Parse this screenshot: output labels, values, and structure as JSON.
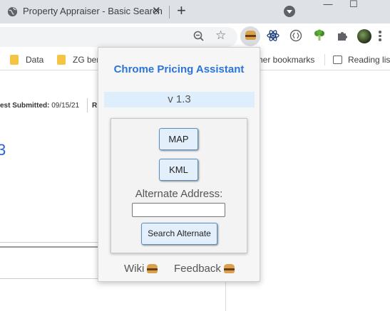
{
  "browser": {
    "tab": {
      "title": "Property Appraiser - Basic Search",
      "close": "✕"
    },
    "new_tab": "+",
    "window_controls": {
      "minimize": "—",
      "maximize": "☐"
    },
    "bookmarks": [
      {
        "label": "Data",
        "icon": "folder-icon"
      },
      {
        "label": "ZG ber",
        "icon": "folder-icon"
      },
      {
        "label": "her bookmarks",
        "icon": "none"
      },
      {
        "label": "Reading list",
        "icon": "reading-list-icon"
      }
    ],
    "extensions": [
      "burger-extension-icon",
      "react-icon",
      "code-bracket-icon",
      "broccoli-icon",
      "puzzle-icon"
    ],
    "colors": {
      "tabstrip": "#dee1e6",
      "toolbar": "#ffffff",
      "omnibox": "#f1f3f4"
    }
  },
  "page": {
    "last_submitted_label": "est Submitted:",
    "last_submitted_value": "09/15/21",
    "fragment": "R",
    "big_number": "3"
  },
  "popup": {
    "title": "Chrome Pricing Assistant",
    "version": "v 1.3",
    "map_button": "MAP",
    "kml_button": "KML",
    "alt_address_label": "Alternate Address:",
    "alt_address_value": "",
    "search_alt_button": "Search Alternate",
    "wiki_link": "Wiki",
    "feedback_link": "Feedback",
    "colors": {
      "title": "#2b74d8",
      "version_bg": "#dfeefc",
      "button_bg": "#e3f0fb",
      "button_border": "#5a8fc0"
    }
  }
}
